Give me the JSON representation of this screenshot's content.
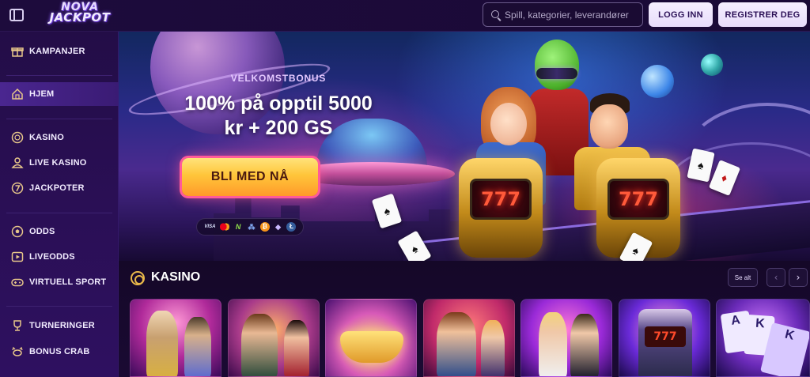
{
  "brand": {
    "logo_line1": "NOVA",
    "logo_line2": "JACKPOT"
  },
  "header": {
    "search": {
      "placeholder": "Spill, kategorier, leverandører"
    },
    "login_label": "LOGG INN",
    "register_label": "REGISTRER DEG"
  },
  "sidebar": {
    "items": [
      {
        "label": "KAMPANJER",
        "icon": "gift-icon",
        "active": false
      },
      {
        "label": "HJEM",
        "icon": "home-icon",
        "active": true
      },
      {
        "label": "KASINO",
        "icon": "chip-icon",
        "active": false
      },
      {
        "label": "LIVE KASINO",
        "icon": "dealer-icon",
        "active": false
      },
      {
        "label": "JACKPOTER",
        "icon": "seven-icon",
        "active": false
      },
      {
        "label": "ODDS",
        "icon": "football-icon",
        "active": false
      },
      {
        "label": "LIVEODDS",
        "icon": "play-icon",
        "active": false
      },
      {
        "label": "VIRTUELL SPORT",
        "icon": "gamepad-icon",
        "active": false
      },
      {
        "label": "TURNERINGER",
        "icon": "trophy-icon",
        "active": false
      },
      {
        "label": "BONUS CRAB",
        "icon": "crab-icon",
        "active": false
      }
    ]
  },
  "hero": {
    "eyebrow": "VELKOMSTBONUS",
    "headline_line1": "100% på opptil 5000",
    "headline_line2": "kr + 200 GS",
    "cta_label": "BLI MED NÅ",
    "payment_methods": [
      "VISA",
      "Mastercard",
      "Neteller",
      "Ripple",
      "Bitcoin",
      "Ethereum",
      "Litecoin"
    ],
    "payment_glyphs": {
      "visa": "VISA",
      "mc": "",
      "neteller": "N",
      "ripple": "⁂",
      "btc": "₿",
      "eth": "◆",
      "ltc": "Ł"
    },
    "slot_display": "777",
    "card_glyphs": [
      "♠",
      "♠",
      "♦",
      "♠",
      "♠"
    ]
  },
  "casino_section": {
    "title": "KASINO",
    "see_all_label": "Se alt",
    "prev_glyph": "‹",
    "next_glyph": "›",
    "games": [
      {
        "theme": "greek-gods"
      },
      {
        "theme": "adventurer"
      },
      {
        "theme": "golden-crown"
      },
      {
        "theme": "pirate-gunslinger"
      },
      {
        "theme": "live-dealers"
      },
      {
        "theme": "slot-machine",
        "display": "777"
      },
      {
        "theme": "playing-cards",
        "glyphs": [
          "A",
          "K",
          "K"
        ]
      }
    ]
  },
  "colors": {
    "background": "#12062a",
    "sidebar": "#2a0f55",
    "sidebar_active": "#4a2690",
    "accent_gold": "#e8b84a",
    "cta_gradient_top": "#ffe37a",
    "cta_gradient_bottom": "#ff9a2a",
    "cta_glow": "#ff5a9a",
    "header_button_bg": "#f2eaff",
    "header_button_text": "#2b1056"
  }
}
